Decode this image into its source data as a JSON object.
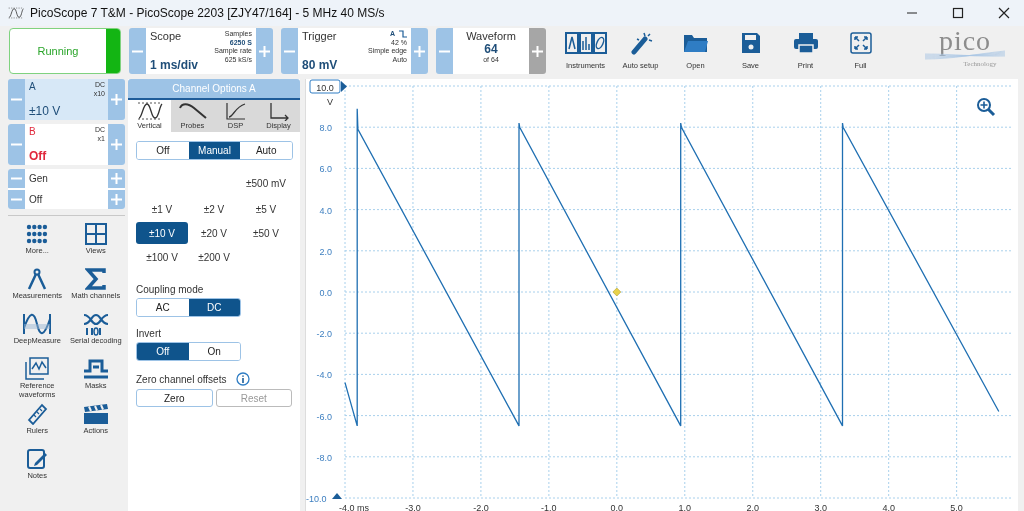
{
  "window": {
    "title": "PicoScope 7 T&M  - PicoScope 2203 [ZJY47/164] - 5 MHz 40 MS/s"
  },
  "run_button": {
    "label": "Running",
    "on": true
  },
  "scope": {
    "title": "Scope",
    "value": "1 ms/div",
    "samples_label": "Samples",
    "samples": "6250 S",
    "rate_label": "Sample rate",
    "rate": "625 kS/s"
  },
  "trigger": {
    "title": "Trigger",
    "value": "80 mV",
    "channel": "A",
    "percent": "42 %",
    "type": "Simple edge",
    "mode": "Auto"
  },
  "waveform": {
    "title": "Waveform",
    "value": "64",
    "total": "of 64",
    "next_disabled": true
  },
  "toolbar": [
    {
      "label": "Instruments"
    },
    {
      "label": "Auto setup"
    },
    {
      "label": "Open"
    },
    {
      "label": "Save"
    },
    {
      "label": "Print"
    },
    {
      "label": "Full"
    }
  ],
  "logo": {
    "name": "pico",
    "tagline": "Technology"
  },
  "channels": [
    {
      "name": "A",
      "coupling": "DC",
      "probe": "x10",
      "range": "±10 V",
      "selected": true,
      "enabled": true,
      "color": "#1f4e79"
    },
    {
      "name": "B",
      "coupling": "DC",
      "probe": "x1",
      "range": "Off",
      "selected": false,
      "enabled": false,
      "color": "#e0283c"
    }
  ],
  "generator": {
    "label": "Gen",
    "value": "Off"
  },
  "tools": [
    {
      "label": "More..."
    },
    {
      "label": "Views"
    },
    {
      "label": "Measurements"
    },
    {
      "label": "Math channels"
    },
    {
      "label": "DeepMeasure"
    },
    {
      "label": "Serial decoding"
    },
    {
      "label": "Reference waveforms"
    },
    {
      "label": "Masks"
    },
    {
      "label": "Rulers"
    },
    {
      "label": "Actions"
    },
    {
      "label": "Notes"
    }
  ],
  "channel_options": {
    "title": "Channel Options A",
    "tabs": [
      {
        "label": "Vertical",
        "selected": true
      },
      {
        "label": "Probes",
        "selected": false
      },
      {
        "label": "DSP",
        "selected": false
      },
      {
        "label": "Display",
        "selected": false
      }
    ],
    "mode": [
      {
        "label": "Off",
        "selected": false
      },
      {
        "label": "Manual",
        "selected": true
      },
      {
        "label": "Auto",
        "selected": false
      }
    ],
    "ranges": [
      {
        "label": "±500 mV",
        "selected": false
      },
      {
        "label": "±1 V",
        "selected": false
      },
      {
        "label": "±2 V",
        "selected": false
      },
      {
        "label": "±5 V",
        "selected": false
      },
      {
        "label": "±10 V",
        "selected": true
      },
      {
        "label": "±20 V",
        "selected": false
      },
      {
        "label": "±50 V",
        "selected": false
      },
      {
        "label": "±100 V",
        "selected": false
      },
      {
        "label": "±200 V",
        "selected": false
      }
    ],
    "coupling": {
      "label": "Coupling mode",
      "options": [
        {
          "label": "AC",
          "selected": false
        },
        {
          "label": "DC",
          "selected": true
        }
      ]
    },
    "invert": {
      "label": "Invert",
      "options": [
        {
          "label": "Off",
          "selected": true
        },
        {
          "label": "On",
          "selected": false
        }
      ]
    },
    "zero_offsets": {
      "label": "Zero channel offsets",
      "buttons": [
        {
          "label": "Zero",
          "disabled": false
        },
        {
          "label": "Reset",
          "disabled": true
        }
      ]
    }
  },
  "plot": {
    "top_marker": "10.0",
    "unit": "V",
    "bottom_marker": "-10.0",
    "chart_data": {
      "type": "line",
      "grid": true,
      "xlim": [
        -4,
        5.8
      ],
      "ylim": [
        -10,
        10
      ],
      "xticks": [
        {
          "value": -4,
          "label": "-4.0 ms"
        },
        {
          "value": -3,
          "label": "-3.0"
        },
        {
          "value": -2,
          "label": "-2.0"
        },
        {
          "value": -1,
          "label": "-1.0"
        },
        {
          "value": 0,
          "label": "0.0"
        },
        {
          "value": 1,
          "label": "1.0"
        },
        {
          "value": 2,
          "label": "2.0"
        },
        {
          "value": 3,
          "label": "3.0"
        },
        {
          "value": 4,
          "label": "4.0"
        },
        {
          "value": 5,
          "label": "5.0"
        }
      ],
      "yticks": [
        {
          "value": 8,
          "label": "8.0"
        },
        {
          "value": 6,
          "label": "6.0"
        },
        {
          "value": 4,
          "label": "4.0"
        },
        {
          "value": 2,
          "label": "2.0"
        },
        {
          "value": 0,
          "label": "0.0"
        },
        {
          "value": -2,
          "label": "-2.0"
        },
        {
          "value": -4,
          "label": "-4.0"
        },
        {
          "value": -6,
          "label": "-6.0"
        },
        {
          "value": -8,
          "label": "-8.0"
        }
      ],
      "x": [
        -4,
        -3.82,
        -3.82,
        -3.81,
        -1.44,
        -1.44,
        -1.43,
        0.94,
        0.94,
        0.95,
        3.32,
        3.32,
        3.33,
        5.62
      ],
      "series": [
        {
          "color": "#1f6fb2",
          "values": [
            -4.4,
            -6.5,
            8.9,
            7.9,
            -6.5,
            8.2,
            8.0,
            -6.5,
            8.2,
            8.0,
            -6.5,
            8.2,
            8.0,
            -5.8
          ]
        }
      ]
    }
  }
}
